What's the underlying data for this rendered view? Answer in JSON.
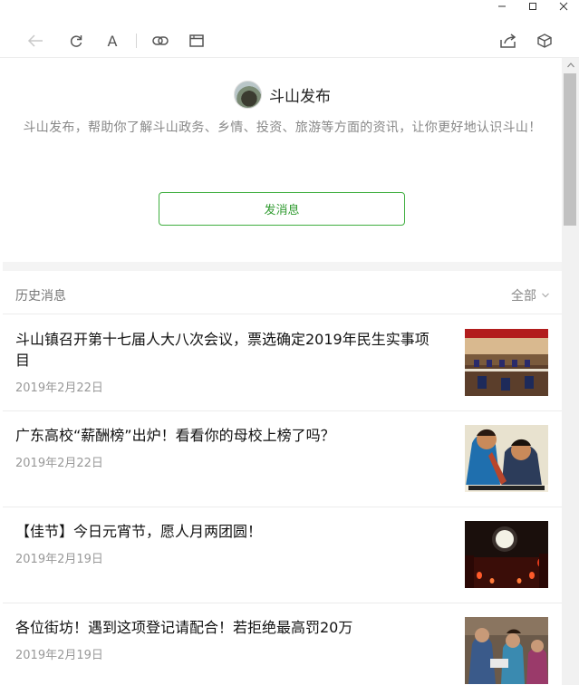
{
  "window": {
    "controls": [
      "minimize-icon",
      "maximize-icon",
      "close-icon"
    ]
  },
  "toolbar": {
    "back_icon": "arrow-left-icon",
    "refresh_icon": "refresh-icon",
    "font_label": "A",
    "link_icon": "link-icon",
    "window_icon": "window-icon",
    "share_icon": "share-icon",
    "cube_icon": "cube-icon"
  },
  "account": {
    "name": "斗山发布",
    "description": "斗山发布，帮助你了解斗山政务、乡情、投资、旅游等方面的资讯，让你更好地认识斗山！",
    "send_button": "发消息"
  },
  "history": {
    "title": "历史消息",
    "filter": "全部",
    "articles": [
      {
        "title": "斗山镇召开第十七届人大八次会议，票选确定2019年民生实事项目",
        "date": "2019年2月22日"
      },
      {
        "title": "广东高校“薪酬榜”出炉！看看你的母校上榜了吗？",
        "date": "2019年2月22日"
      },
      {
        "title": "【佳节】今日元宵节，愿人月两团圆！",
        "date": "2019年2月19日"
      },
      {
        "title": "各位街坊！遇到这项登记请配合！若拒绝最高罚20万",
        "date": "2019年2月19日"
      }
    ]
  },
  "colors": {
    "accent_green": "#2f9a2f",
    "muted_text": "#888888"
  }
}
